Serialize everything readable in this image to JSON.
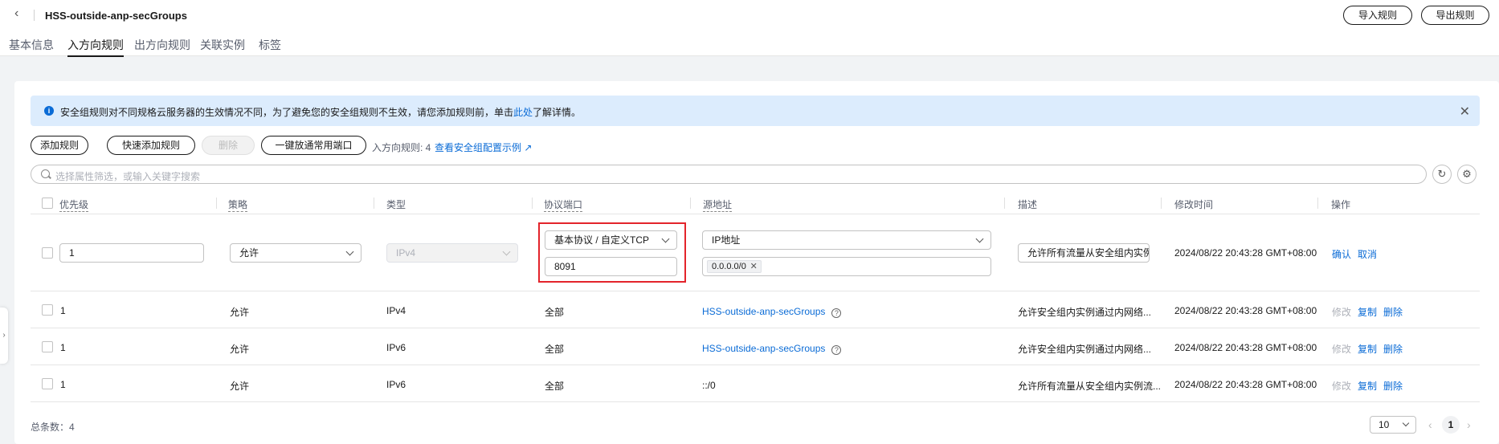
{
  "header": {
    "title": "HSS-outside-anp-secGroups",
    "import_label": "导入规则",
    "export_label": "导出规则"
  },
  "tabs": [
    "基本信息",
    "入方向规则",
    "出方向规则",
    "关联实例",
    "标签"
  ],
  "active_tab": "入方向规则",
  "notice": {
    "text_before": "安全组规则对不同规格云服务器的生效情况不同，为了避免您的安全组规则不生效，请您添加规则前，单击",
    "link": "此处",
    "text_after": "了解详情。"
  },
  "toolbar": {
    "add_rule": "添加规则",
    "quick_add": "快速添加规则",
    "delete": "删除",
    "open_common_ports": "一键放通常用端口",
    "rule_count_label": "入方向规则: 4",
    "example_link": "查看安全组配置示例"
  },
  "search": {
    "placeholder": "选择属性筛选，或输入关键字搜索"
  },
  "columns": [
    "优先级",
    "策略",
    "类型",
    "协议端口",
    "源地址",
    "描述",
    "修改时间",
    "操作"
  ],
  "edit_row": {
    "priority": "1",
    "policy": "允许",
    "type": "IPv4",
    "protocol": "基本协议 / 自定义TCP",
    "port": "8091",
    "source_type": "IP地址",
    "source_tag": "0.0.0.0/0",
    "description": "允许所有流量从安全组内实例",
    "modified": "2024/08/22 20:43:28 GMT+08:00",
    "confirm": "确认",
    "cancel": "取消"
  },
  "rows": [
    {
      "priority": "1",
      "policy": "允许",
      "type": "IPv4",
      "port": "全部",
      "source": "HSS-outside-anp-secGroups",
      "description": "允许安全组内实例通过内网络...",
      "modified": "2024/08/22 20:43:28 GMT+08:00"
    },
    {
      "priority": "1",
      "policy": "允许",
      "type": "IPv6",
      "port": "全部",
      "source": "HSS-outside-anp-secGroups",
      "description": "允许安全组内实例通过内网络...",
      "modified": "2024/08/22 20:43:28 GMT+08:00"
    },
    {
      "priority": "1",
      "policy": "允许",
      "type": "IPv6",
      "port": "全部",
      "source": "::/0",
      "description": "允许所有流量从安全组内实例流...",
      "modified": "2024/08/22 20:43:28 GMT+08:00"
    }
  ],
  "row_actions": {
    "modify": "修改",
    "copy": "复制",
    "delete": "删除"
  },
  "footer": {
    "total": "总条数：4",
    "page_size": "10",
    "page": "1"
  },
  "icons": {
    "info": "info-icon",
    "close": "close-icon",
    "search": "search-icon",
    "refresh": "refresh-icon",
    "settings": "settings-icon",
    "help": "help-icon",
    "external": "external-link-icon"
  },
  "colors": {
    "accent": "#0a6bd6",
    "highlight": "#e3242b",
    "notice_bg": "#dcecfd"
  }
}
